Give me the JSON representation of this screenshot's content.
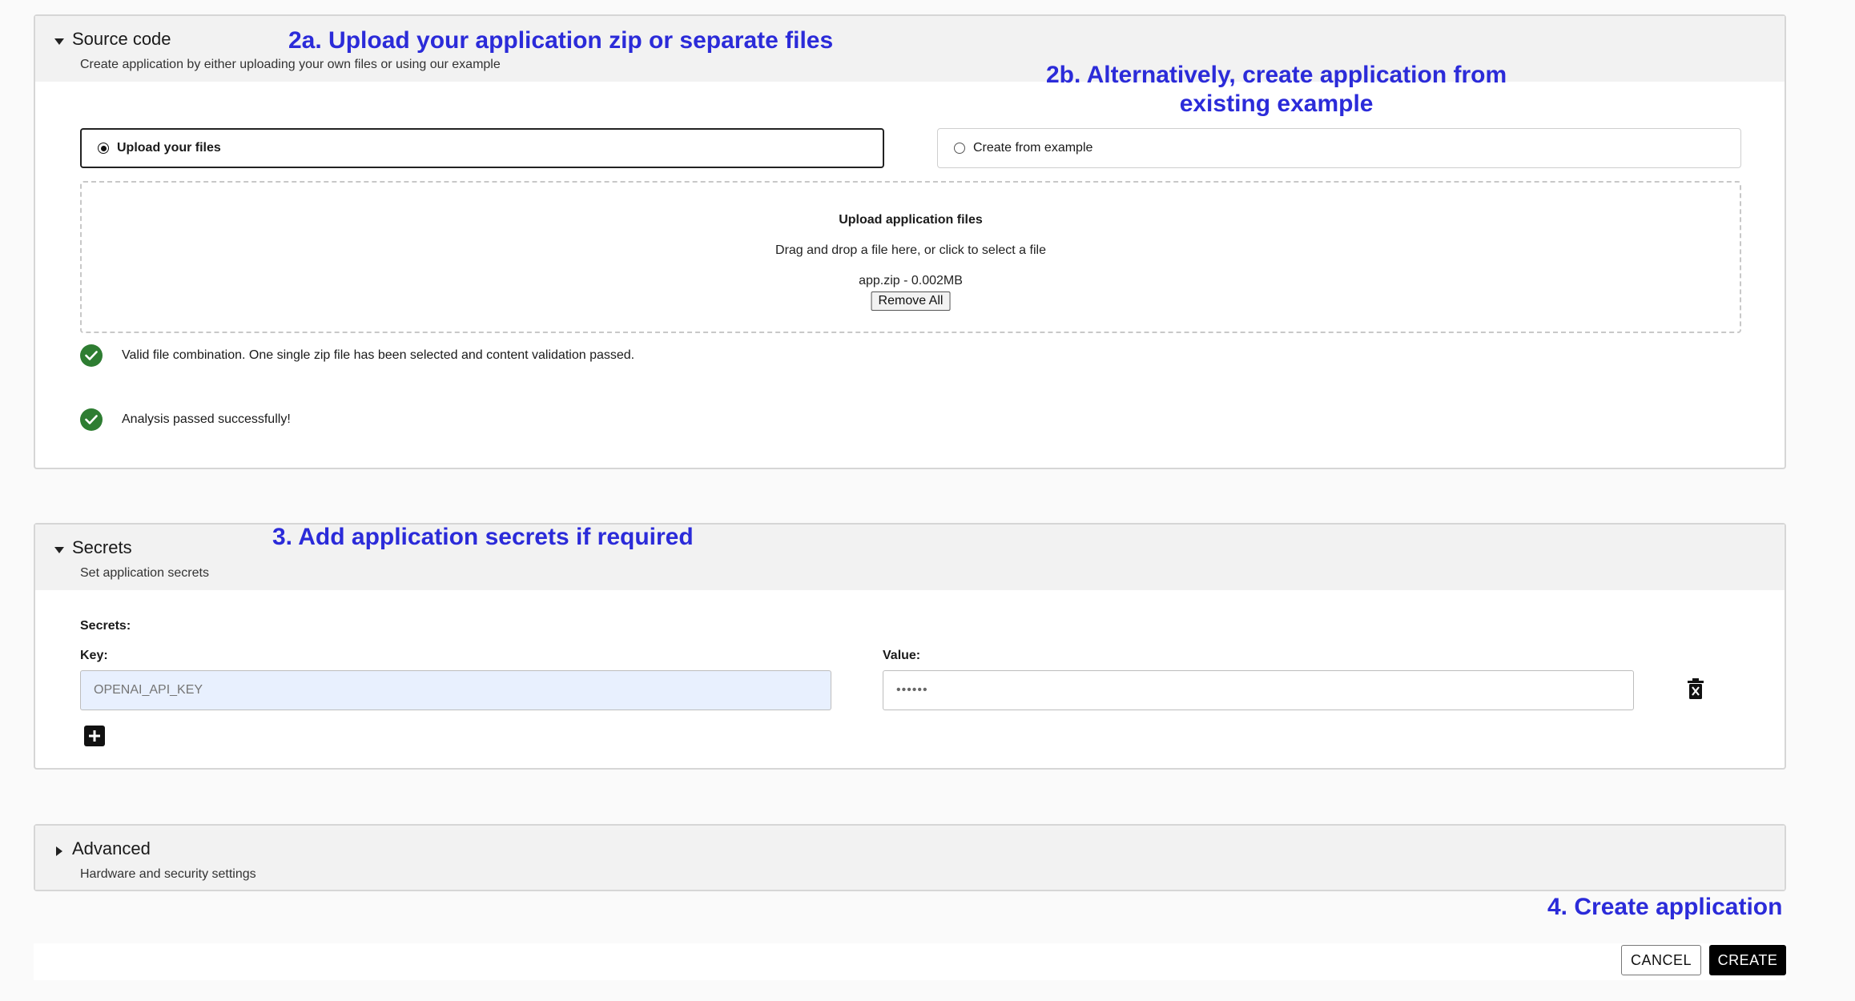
{
  "annotations": {
    "step_2a": "2a. Upload your application zip or separate files",
    "step_2b_line1": "2b. Alternatively, create application from",
    "step_2b_line2": "existing example",
    "step_3": "3. Add application secrets if required",
    "step_4": "4. Create application",
    "color": "#2b2bd9"
  },
  "source_code": {
    "title": "Source code",
    "subtitle": "Create application by either uploading your own files or using our example",
    "options": [
      {
        "label": "Upload your files",
        "selected": true
      },
      {
        "label": "Create from example",
        "selected": false
      }
    ],
    "dropzone": {
      "title": "Upload application files",
      "hint": "Drag and drop a file here, or click to select a file",
      "file": "app.zip - 0.002MB",
      "remove_label": "Remove All"
    },
    "statuses": [
      "Valid file combination. One single zip file has been selected and content validation passed.",
      "Analysis passed successfully!"
    ],
    "status_color": "#2e7d32"
  },
  "secrets": {
    "title": "Secrets",
    "subtitle": "Set application secrets",
    "section_label": "Secrets:",
    "key_label": "Key:",
    "value_label": "Value:",
    "key_placeholder": "OPENAI_API_KEY",
    "value_masked": "••••••"
  },
  "advanced": {
    "title": "Advanced",
    "subtitle": "Hardware and security settings"
  },
  "footer": {
    "cancel_label": "CANCEL",
    "create_label": "CREATE"
  }
}
